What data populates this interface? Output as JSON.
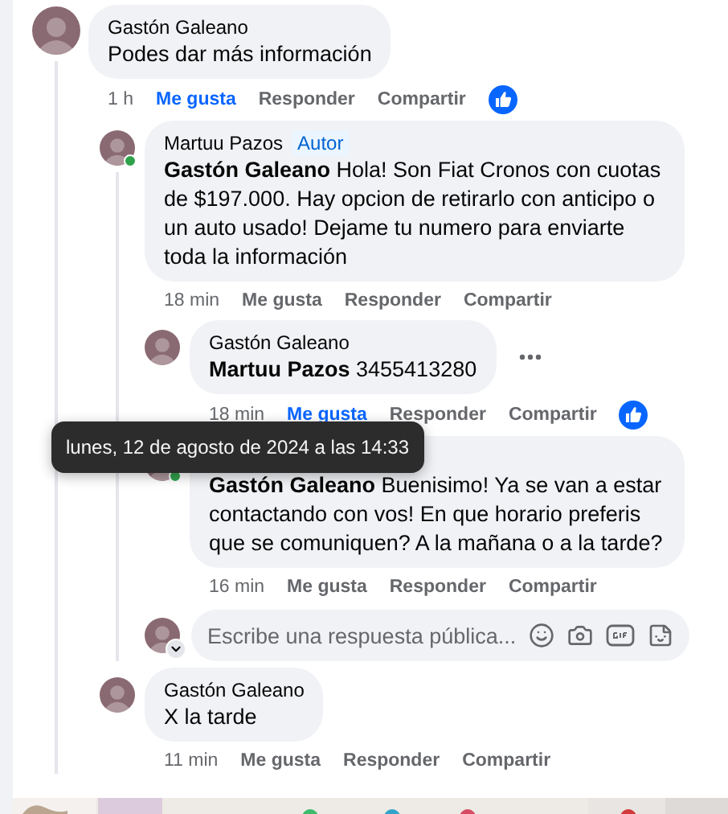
{
  "comments": [
    {
      "kind": "comment",
      "author": "Gastón Galeano",
      "text": "Podes dar más información",
      "time": "1 h",
      "actions": [
        "Me gusta",
        "Responder",
        "Compartir"
      ],
      "liked": true,
      "children": [
        {
          "kind": "comment",
          "author": "Martuu Pazos",
          "badge": "Autor",
          "online": true,
          "text": "**Gastón Galeano** Hola! Son Fiat Cronos con cuotas de $197.000. Hay opcion de retirarlo con anticipo o un auto usado! Dejame tu numero para enviarte toda la información",
          "time": "18 min",
          "actions": [
            "Me gusta",
            "Responder",
            "Compartir"
          ],
          "liked": false,
          "children": [
            {
              "kind": "comment",
              "author": "Gastón Galeano",
              "text": "**Martuu Pazos** 3455413280",
              "time": "18 min",
              "actions": [
                "Me gusta",
                "Responder",
                "Compartir"
              ],
              "liked": true,
              "more_menu": true
            },
            {
              "kind": "comment",
              "online": true,
              "text": "**Gastón Galeano** Buenisimo! Ya se van a estar contactando con vos! En que horario preferis que se comuniquen? A la mañana o a la tarde?",
              "time": "16 min",
              "actions": [
                "Me gusta",
                "Responder",
                "Compartir"
              ],
              "liked": false,
              "tooltip": "lunes, 12 de agosto de 2024 a las 14:33"
            },
            {
              "kind": "reply_box",
              "placeholder": "Escribe una respuesta pública..."
            }
          ]
        },
        {
          "kind": "comment",
          "author": "Gastón Galeano",
          "text": "X la tarde",
          "time": "11 min",
          "actions": [
            "Me gusta",
            "Responder",
            "Compartir"
          ],
          "liked": false
        }
      ]
    }
  ]
}
